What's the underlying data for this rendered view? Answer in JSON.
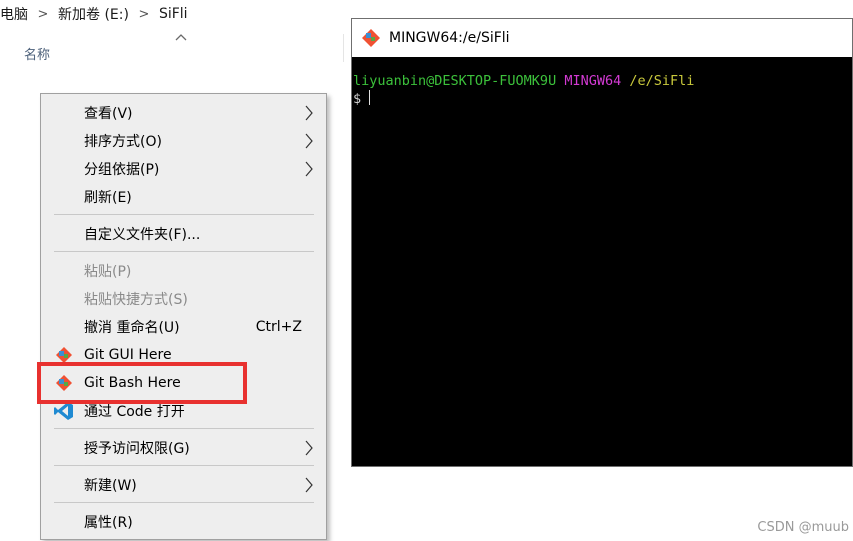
{
  "breadcrumb": {
    "items": [
      "电脑",
      "新加卷 (E:)",
      "SiFli"
    ],
    "separator": ">"
  },
  "explorer": {
    "column_name": "名称",
    "sort_indicator": "chevron-up-icon"
  },
  "context_menu": {
    "items": [
      {
        "label": "查看(V)",
        "submenu": true,
        "enabled": true
      },
      {
        "label": "排序方式(O)",
        "submenu": true,
        "enabled": true
      },
      {
        "label": "分组依据(P)",
        "submenu": true,
        "enabled": true
      },
      {
        "label": "刷新(E)",
        "submenu": false,
        "enabled": true
      },
      {
        "label": "自定义文件夹(F)...",
        "submenu": false,
        "enabled": true
      },
      {
        "label": "粘贴(P)",
        "submenu": false,
        "enabled": false
      },
      {
        "label": "粘贴快捷方式(S)",
        "submenu": false,
        "enabled": false
      },
      {
        "label": "撤消 重命名(U)",
        "shortcut": "Ctrl+Z",
        "submenu": false,
        "enabled": true
      },
      {
        "label": "Git GUI Here",
        "icon": "git-icon",
        "submenu": false,
        "enabled": true
      },
      {
        "label": "Git Bash Here",
        "icon": "git-icon",
        "submenu": false,
        "enabled": true,
        "highlighted": true
      },
      {
        "label": "通过 Code 打开",
        "icon": "vscode-icon",
        "submenu": false,
        "enabled": true
      },
      {
        "label": "授予访问权限(G)",
        "submenu": true,
        "enabled": true
      },
      {
        "label": "新建(W)",
        "submenu": true,
        "enabled": true
      },
      {
        "label": "属性(R)",
        "submenu": false,
        "enabled": true
      }
    ]
  },
  "terminal": {
    "title": "MINGW64:/e/SiFli",
    "prompt_user": "liyuanbin@DESKTOP-FUOMK9U",
    "prompt_env": "MINGW64",
    "prompt_path": "/e/SiFli",
    "prompt_symbol": "$"
  },
  "watermark": "CSDN @muub",
  "colors": {
    "highlight": "#e8312f",
    "term_green": "#3cc13b",
    "term_magenta": "#d33ad3",
    "term_yellow": "#c9c93c",
    "git_orange": "#f05133"
  }
}
